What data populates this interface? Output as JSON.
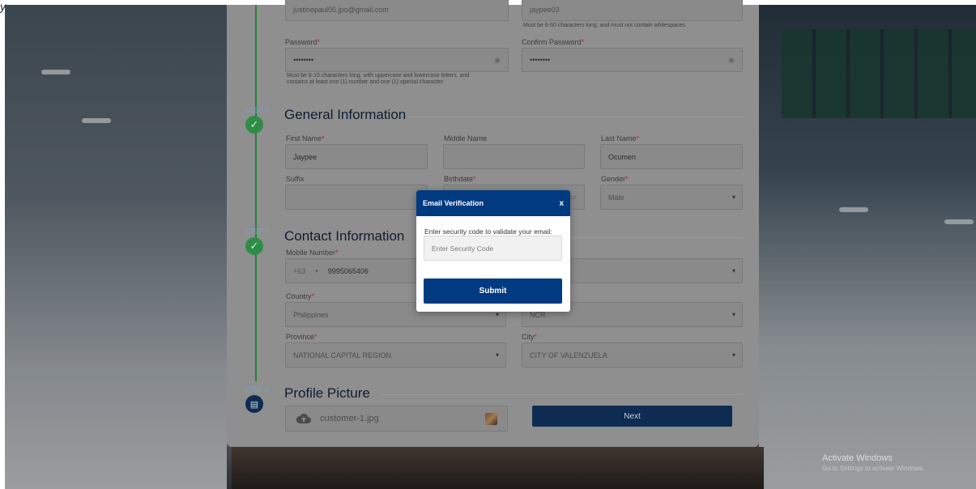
{
  "account": {
    "email_value": "justinepaul05.jpo@gmail.com",
    "username_value": "jaypee03",
    "username_hint": "Must be 6-50 characters long, and must not contain whitespaces.",
    "password_label": "Password",
    "password_value": "••••••••",
    "confirm_password_label": "Confirm Password",
    "confirm_password_value": "••••••••",
    "password_hint_line1": "Must be 8-15 characters long, with uppercase and lowercase letters, and",
    "password_hint_line2": "contains at least one (1) number and one (1) special character."
  },
  "steps": {
    "step2_label": "STEP 2",
    "step3_label": "STEP 3",
    "step4_label": "STEP 4"
  },
  "general": {
    "title": "General Information",
    "first_name_label": "First Name",
    "first_name_value": "Jaypee",
    "middle_name_label": "Middle Name",
    "middle_name_value": "",
    "last_name_label": "Last Name",
    "last_name_value": "Ocumen",
    "suffix_label": "Suffix",
    "suffix_value": "",
    "birthdate_label": "Birthdate",
    "gender_label": "Gender",
    "gender_value": "Male"
  },
  "contact": {
    "title": "Contact Information",
    "mobile_label": "Mobile Number",
    "country_code": "+63",
    "mobile_value": "9995065406",
    "country_label": "Country",
    "country_value": "Philippines",
    "region_value": "NCR",
    "province_label": "Province",
    "province_value": "NATIONAL CAPITAL REGION",
    "city_label": "City",
    "city_value": "CITY OF VALENZUELA"
  },
  "profile": {
    "title": "Profile Picture",
    "file_name": "customer-1.jpg",
    "next_label": "Next"
  },
  "modal": {
    "title": "Email Verification",
    "close_label": "x",
    "prompt": "Enter security code to validate your email:",
    "input_placeholder": "Enter Security Code",
    "submit_label": "Submit"
  },
  "windows": {
    "activate_title": "Activate Windows",
    "activate_subtitle": "Go to Settings to activate Windows."
  },
  "colors": {
    "primary": "#003a80",
    "step_done": "#2f8c47",
    "required": "#b2262b"
  }
}
